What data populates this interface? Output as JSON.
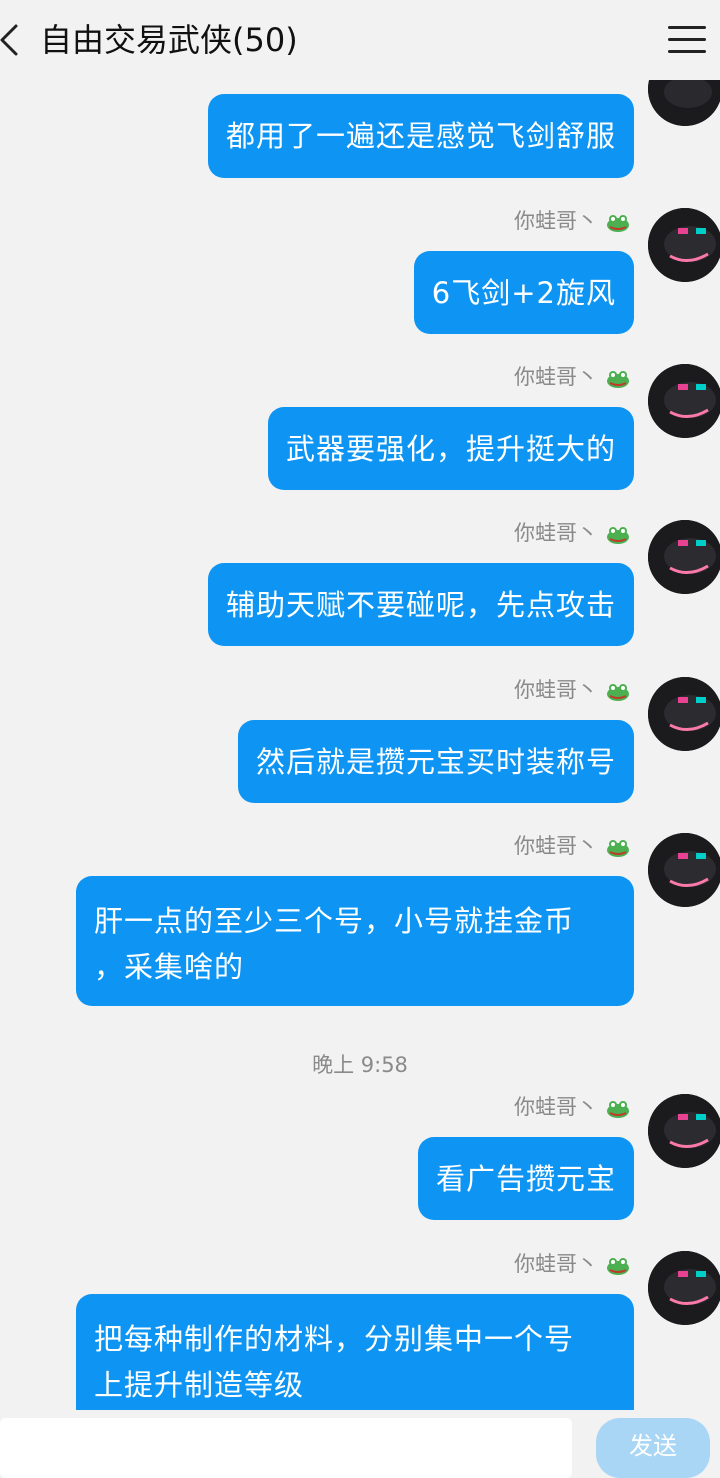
{
  "header": {
    "title": "自由交易武侠(50)"
  },
  "messages": [
    {
      "sender": "",
      "text": "都用了一遍还是感觉飞剑舒服"
    },
    {
      "sender": "你蛙哥丶",
      "text": "6飞剑+2旋风"
    },
    {
      "sender": "你蛙哥丶",
      "text": "武器要强化，提升挺大的"
    },
    {
      "sender": "你蛙哥丶",
      "text": "辅助天赋不要碰呢，先点攻击"
    },
    {
      "sender": "你蛙哥丶",
      "text": "然后就是攒元宝买时装称号"
    },
    {
      "sender": "你蛙哥丶",
      "line1": "肝一点的至少三个号，小号就挂金币",
      "line2": "，采集啥的"
    },
    {
      "sender": "你蛙哥丶",
      "text": "看广告攒元宝"
    },
    {
      "sender": "你蛙哥丶",
      "line1": "把每种制作的材料，分别集中一个号",
      "line2": "上提升制造等级"
    }
  ],
  "timestamp": "晚上 9:58",
  "input": {
    "send_label": "发送"
  },
  "colors": {
    "bubble": "#0e95f4",
    "background": "#f2f2f2",
    "send_button": "#a9d6f5"
  }
}
